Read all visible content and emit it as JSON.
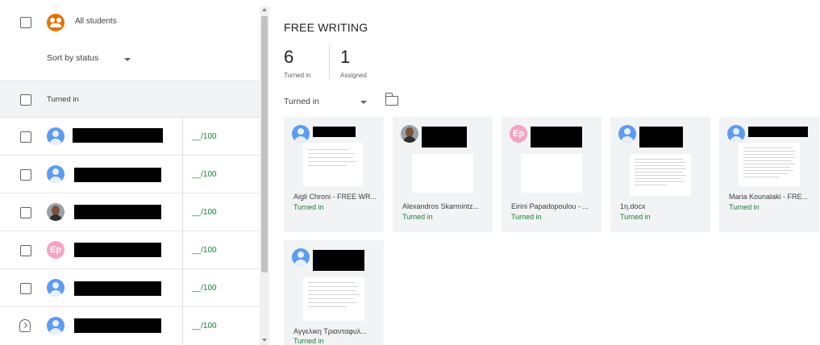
{
  "left": {
    "all_students_label": "All students",
    "sort_label": "Sort by status",
    "section_label": "Turned in",
    "students": [
      {
        "avatar": "generic",
        "grade": "__/100"
      },
      {
        "avatar": "generic",
        "grade": "__/100"
      },
      {
        "avatar": "photo",
        "grade": "__/100"
      },
      {
        "avatar": "initials",
        "initials": "Ep",
        "grade": "__/100"
      },
      {
        "avatar": "generic",
        "grade": "__/100"
      },
      {
        "avatar": "generic",
        "grade": "__/100"
      }
    ]
  },
  "right": {
    "title": "FREE WRITING",
    "stats": {
      "turned_in_count": "6",
      "turned_in_label": "Turned in",
      "assigned_count": "1",
      "assigned_label": "Assigned"
    },
    "filter_label": "Turned in",
    "cards": [
      {
        "file": "Aigli Chroni - FREE WR...",
        "status": "Turned in"
      },
      {
        "file": "Alexandros Skarmintz...",
        "status": "Turned in"
      },
      {
        "file": "Eirini Papadopoulou - ...",
        "status": "Turned in"
      },
      {
        "file": "1η.docx",
        "status": "Turned in"
      },
      {
        "file": "Maria Kounalaki - FRE...",
        "status": "Turned in"
      },
      {
        "file": "Αγγελικη Τριανταφυλ...",
        "status": "Turned in"
      }
    ]
  },
  "icons": {
    "group": "group-avatar-icon",
    "folder": "folder-icon",
    "returned": "returned-shield-icon",
    "dropdown": "chevron-down-icon"
  },
  "colors": {
    "accent_green": "#188038",
    "group_orange": "#e37400",
    "avatar_blue": "#5b9cf4",
    "initials_pink": "#f6a3c1"
  }
}
